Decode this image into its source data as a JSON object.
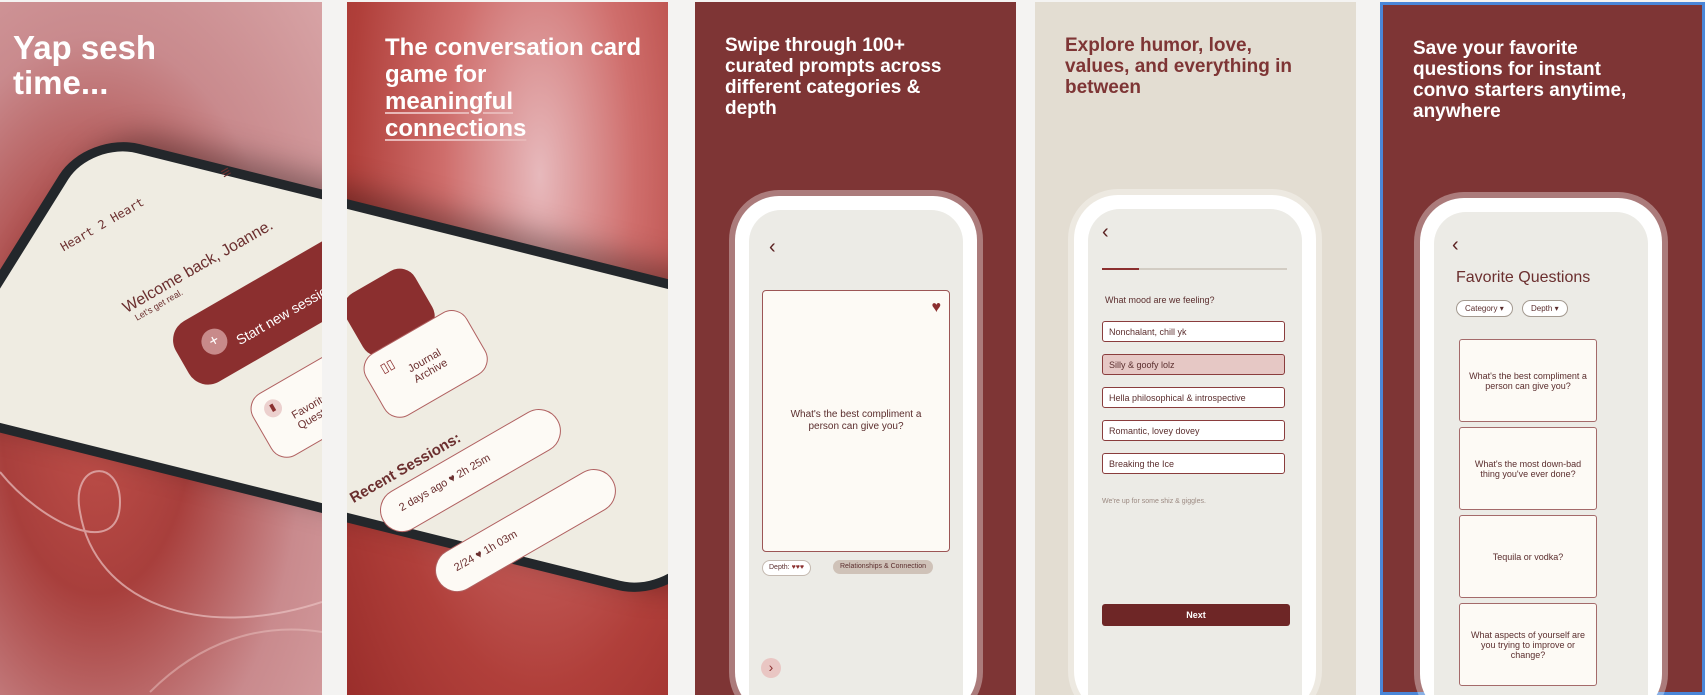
{
  "panels": {
    "p1": {
      "headline": "Yap sesh time...",
      "app_name": "Heart 2 Heart",
      "welcome": "Welcome back, Joanne.",
      "subwelcome": "Let's get real.",
      "start_session": "Start new session",
      "favorites": "Favorite Questions",
      "plus": "+"
    },
    "p2": {
      "headline_1": "The conversation card game for",
      "headline_2": "meaningful connections",
      "journal": "Journal Archive",
      "recent": "Recent Sessions:",
      "session1": "2 days ago ♥ 2h 25m",
      "session2": "2/24 ♥ 1h 03m"
    },
    "p3": {
      "headline": "Swipe through 100+ curated prompts across different categories & depth",
      "question": "What's the best compliment a person can give you?",
      "depth_label": "Depth:",
      "depth_hearts": "♥♥♥",
      "category": "Relationships & Connection",
      "back_glyph": "‹",
      "next_glyph": "›"
    },
    "p4": {
      "headline": "Explore humor, love, values, and everything in between",
      "prompt": "What mood are we feeling?",
      "options": [
        "Nonchalant, chill yk",
        "Silly & goofy lolz",
        "Hella philosophical & introspective",
        "Romantic, lovey dovey",
        "Breaking the Ice"
      ],
      "selected_index": 1,
      "hint": "We're up for some shiz & giggles.",
      "next": "Next",
      "back_glyph": "‹"
    },
    "p5": {
      "headline": "Save your favorite questions for instant convo starters anytime, anywhere",
      "title": "Favorite Questions",
      "filter_category": "Category",
      "filter_depth": "Depth",
      "questions": [
        "What's the best compliment a person can give you?",
        "What's the most down-bad thing you've ever done?",
        "Tequila or vodka?",
        "What aspects of yourself are you trying to improve or change?"
      ],
      "back_glyph": "‹"
    }
  },
  "colors": {
    "brand_maroon": "#7e3535",
    "cream": "#e3ddd2",
    "button": "#6e2626",
    "selected_option": "#e6c8c5",
    "accent_border": "#4a86d8"
  }
}
